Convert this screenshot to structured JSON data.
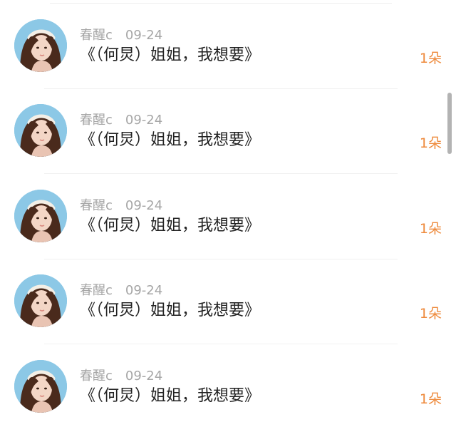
{
  "comments": [
    {
      "username": "春醒c",
      "time": "09-24",
      "message": "《（何炅）姐姐，我想要》",
      "gift": "1朵"
    },
    {
      "username": "春醒c",
      "time": "09-24",
      "message": "《（何炅）姐姐，我想要》",
      "gift": "1朵"
    },
    {
      "username": "春醒c",
      "time": "09-24",
      "message": "《（何炅）姐姐，我想要》",
      "gift": "1朵"
    },
    {
      "username": "春醒c",
      "time": "09-24",
      "message": "《（何炅）姐姐，我想要》",
      "gift": "1朵"
    },
    {
      "username": "春醒c",
      "time": "09-24",
      "message": "《（何炅）姐姐，我想要》",
      "gift": "1朵"
    }
  ],
  "colors": {
    "username": "#a6a6a6",
    "message": "#222222",
    "gift": "#ee8a3c",
    "avatar_bg": "#8cc8e6"
  }
}
